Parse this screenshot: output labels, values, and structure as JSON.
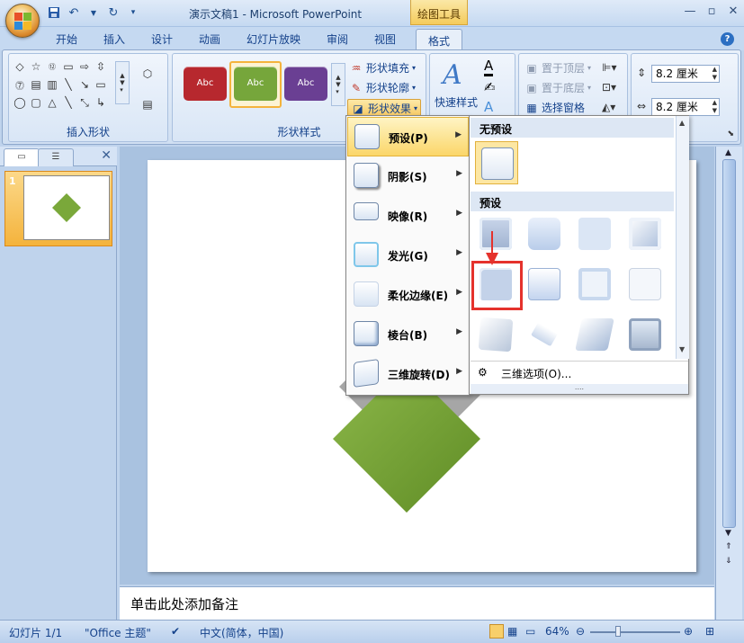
{
  "window": {
    "title": "演示文稿1 - Microsoft PowerPoint",
    "context_tool": "绘图工具"
  },
  "tabs": [
    "开始",
    "插入",
    "设计",
    "动画",
    "幻灯片放映",
    "审阅",
    "视图"
  ],
  "active_tab": "格式",
  "ribbon": {
    "groups": {
      "insert_shapes": "插入形状",
      "shape_styles": "形状样式"
    },
    "style_samples": [
      {
        "label": "Abc",
        "color": "#b7282e"
      },
      {
        "label": "Abc",
        "color": "#76a63b"
      },
      {
        "label": "Abc",
        "color": "#6a3f93"
      }
    ],
    "shape_fill": "形状填充",
    "shape_outline": "形状轮廓",
    "shape_effects": "形状效果",
    "quick_styles": "快速样式",
    "bring_front": "置于顶层",
    "send_back": "置于底层",
    "selection_pane": "选择窗格",
    "height": "8.2 厘米",
    "width": "8.2 厘米"
  },
  "effects_menu": [
    {
      "label": "预设(P)",
      "highlighted": true
    },
    {
      "label": "阴影(S)",
      "highlighted": false
    },
    {
      "label": "映像(R)",
      "highlighted": false
    },
    {
      "label": "发光(G)",
      "highlighted": false
    },
    {
      "label": "柔化边缘(E)",
      "highlighted": false
    },
    {
      "label": "棱台(B)",
      "highlighted": false
    },
    {
      "label": "三维旋转(D)",
      "highlighted": false
    }
  ],
  "gallery": {
    "no_preset": "无预设",
    "preset": "预设",
    "options_3d": "三维选项(O)...",
    "resize_dots": "...."
  },
  "slides": {
    "number": "1"
  },
  "notes_placeholder": "单击此处添加备注",
  "status": {
    "slide": "幻灯片 1/1",
    "theme": "\"Office 主题\"",
    "language": "中文(简体，中国)",
    "zoom": "64%"
  },
  "colors": {
    "shape_green": "#7aa83a",
    "accent_orange": "#f4b33c",
    "highlight_red": "#e5322c"
  }
}
